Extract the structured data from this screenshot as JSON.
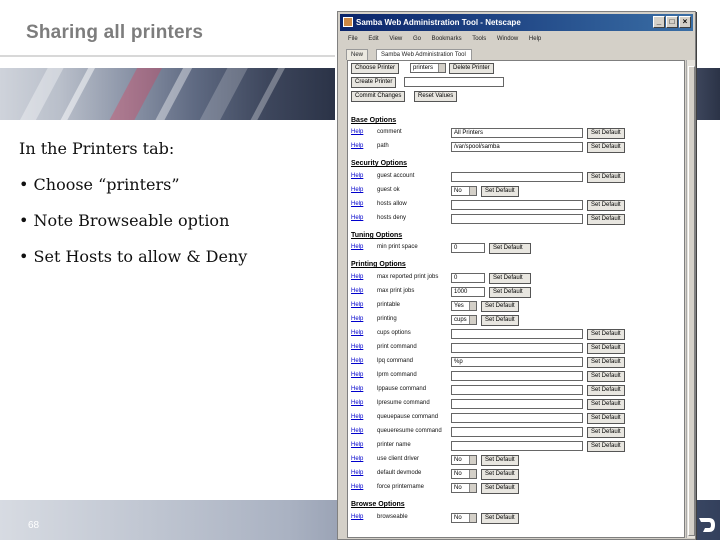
{
  "slide": {
    "title": "Sharing all printers",
    "bullets": [
      "In the Printers tab:",
      "• Choose “printers”",
      "• Note Browseable option",
      "• Set Hosts to allow & Deny"
    ],
    "page_number": "68"
  },
  "browser": {
    "window_title": "Samba Web Administration Tool - Netscape",
    "menu": [
      "File",
      "Edit",
      "View",
      "Go",
      "Bookmarks",
      "Tools",
      "Window",
      "Help"
    ],
    "tab_new": "New",
    "tab_active": "Samba Web Administration Tool",
    "controls": {
      "choose_printer": "Choose Printer",
      "printer_select": "printers",
      "delete_printer": "Delete Printer",
      "create_printer": "Create Printer",
      "commit_changes": "Commit Changes",
      "reset_values": "Reset Values"
    },
    "help_label": "Help",
    "set_default": "Set Default",
    "sections": {
      "base": "Base Options",
      "security": "Security Options",
      "tuning": "Tuning Options",
      "printing": "Printing Options",
      "browse": "Browse Options"
    },
    "base_rows": [
      {
        "param": "comment",
        "value": "All Printers"
      },
      {
        "param": "path",
        "value": "/var/spool/samba"
      }
    ],
    "security_rows": [
      {
        "param": "guest account",
        "value": ""
      },
      {
        "param": "guest ok",
        "value": "No"
      },
      {
        "param": "hosts allow",
        "value": ""
      },
      {
        "param": "hosts deny",
        "value": ""
      }
    ],
    "tuning_rows": [
      {
        "param": "min print space",
        "value": "0"
      }
    ],
    "printing_rows": [
      {
        "param": "max reported print jobs",
        "value": "0"
      },
      {
        "param": "max print jobs",
        "value": "1000"
      },
      {
        "param": "printable",
        "value": "Yes"
      },
      {
        "param": "printing",
        "value": "cups"
      },
      {
        "param": "cups options",
        "value": ""
      },
      {
        "param": "print command",
        "value": ""
      },
      {
        "param": "lpq command",
        "value": "%p"
      },
      {
        "param": "lprm command",
        "value": ""
      },
      {
        "param": "lppause command",
        "value": ""
      },
      {
        "param": "lpresume command",
        "value": ""
      },
      {
        "param": "queuepause command",
        "value": ""
      },
      {
        "param": "queueresume command",
        "value": ""
      },
      {
        "param": "printer name",
        "value": ""
      },
      {
        "param": "use client driver",
        "value": "No"
      },
      {
        "param": "default devmode",
        "value": "No"
      },
      {
        "param": "force printername",
        "value": "No"
      }
    ],
    "browse_rows": [
      {
        "param": "browseable",
        "value": "No"
      }
    ]
  }
}
